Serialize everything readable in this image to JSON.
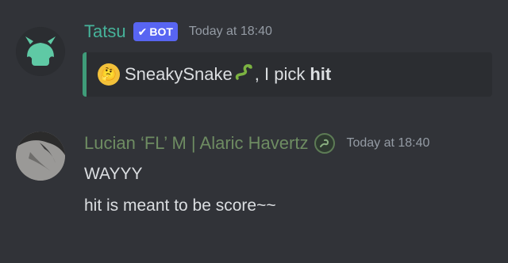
{
  "messages": [
    {
      "author": "Tatsu",
      "badge": "BOT",
      "timestamp": "Today at 18:40",
      "embed": {
        "emoji": "thinking-face",
        "mention": "SneakySnake",
        "mention_emoji": "snake",
        "text": ", I pick",
        "bold": "hit",
        "accent_color": "#3f9c79"
      }
    },
    {
      "author": "Lucian ‘FL’ M | Alaric Havertz",
      "role_icon": "slytherin-crest",
      "timestamp": "Today at 18:40",
      "lines": [
        "WAYYY",
        "hit is meant to be score~~"
      ]
    }
  ],
  "colors": {
    "background": "#313338",
    "bot_name": "#46b39a",
    "user_name": "#6e8c62",
    "badge": "#5865f2"
  }
}
